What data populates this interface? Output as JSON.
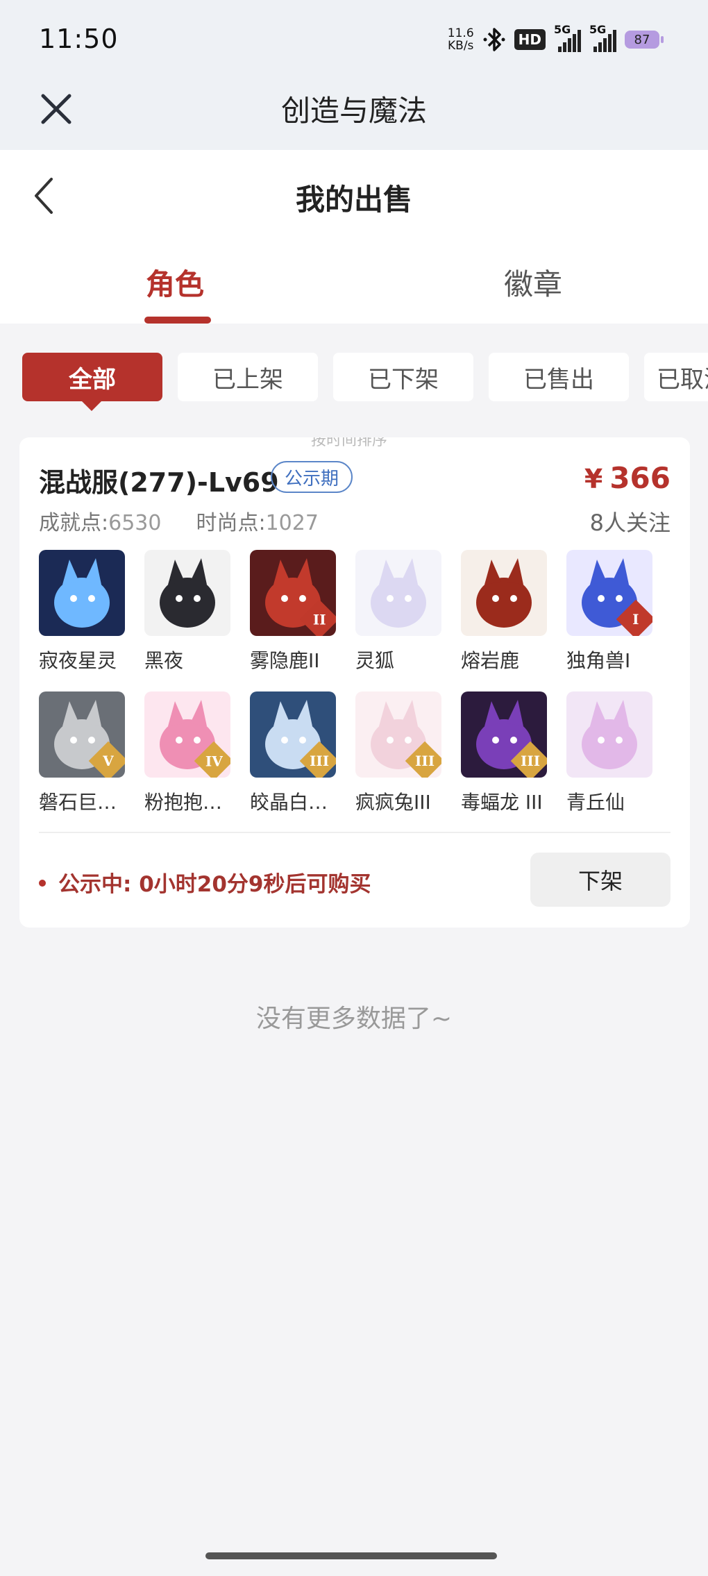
{
  "status_bar": {
    "time": "11:50",
    "net_speed_value": "11.6",
    "net_speed_unit": "KB/s",
    "hd_label": "HD",
    "signal1_label": "5G",
    "signal2_label": "5G",
    "battery": "87",
    "icons": [
      "bluetooth-icon",
      "hd-voice-icon",
      "signal-icon",
      "signal-icon",
      "battery-icon"
    ]
  },
  "app_bar": {
    "title": "创造与魔法",
    "close_icon": "close-icon"
  },
  "page_header": {
    "title": "我的出售",
    "back_icon": "chevron-left-icon",
    "tabs": [
      {
        "label": "角色",
        "active": true
      },
      {
        "label": "徽章",
        "active": false
      }
    ]
  },
  "filters": [
    {
      "label": "全部",
      "active": true
    },
    {
      "label": "已上架",
      "active": false
    },
    {
      "label": "已下架",
      "active": false
    },
    {
      "label": "已售出",
      "active": false
    },
    {
      "label": "已取消",
      "active": false
    }
  ],
  "listing": {
    "ghost_text": "按时间排序",
    "title": "混战服(277)-Lv69",
    "status_tag": "公示期",
    "price_symbol": "¥",
    "price": "366",
    "achievement_label": "成就点:",
    "achievement_value": "6530",
    "fashion_label": "时尚点:",
    "fashion_value": "1027",
    "followers": "8人关注",
    "pets": [
      {
        "name": "寂夜星灵",
        "tier": "",
        "bg": "#1b2a55",
        "fg": "#6fb8ff"
      },
      {
        "name": "黑夜",
        "tier": "",
        "bg": "#f2f2f2",
        "fg": "#2a2a30"
      },
      {
        "name": "雾隐鹿II",
        "tier": "II",
        "bg": "#5a1c1c",
        "fg": "#c23a2c"
      },
      {
        "name": "灵狐",
        "tier": "",
        "bg": "#f4f4fa",
        "fg": "#dcd8f2"
      },
      {
        "name": "熔岩鹿",
        "tier": "",
        "bg": "#f6efe9",
        "fg": "#9b2b1c"
      },
      {
        "name": "独角兽I",
        "tier": "I",
        "bg": "#e9e8ff",
        "fg": "#3f5ad6"
      },
      {
        "name": "磐石巨…",
        "tier": "V",
        "bg": "#6a6f76",
        "fg": "#c7c9cc"
      },
      {
        "name": "粉抱抱…",
        "tier": "IV",
        "bg": "#fde6ef",
        "fg": "#ef8fb4"
      },
      {
        "name": "皎晶白…",
        "tier": "III",
        "bg": "#2f4f7a",
        "fg": "#c9dcf2"
      },
      {
        "name": "疯疯兔III",
        "tier": "III",
        "bg": "#fbeff2",
        "fg": "#f2d2dc"
      },
      {
        "name": "毒蝠龙 III",
        "tier": "III",
        "bg": "#2c1b3d",
        "fg": "#7a3fb8"
      },
      {
        "name": "青丘仙",
        "tier": "",
        "bg": "#f2e6f6",
        "fg": "#e2b8e8"
      }
    ],
    "notice": "公示中: 0小时20分9秒后可购买",
    "delist_button": "下架"
  },
  "footer_text": "没有更多数据了~",
  "colors": {
    "accent": "#b5322c",
    "tag_blue": "#3f6fbf",
    "tier_gold": "#d8a540",
    "tier_red": "#c0392b"
  }
}
